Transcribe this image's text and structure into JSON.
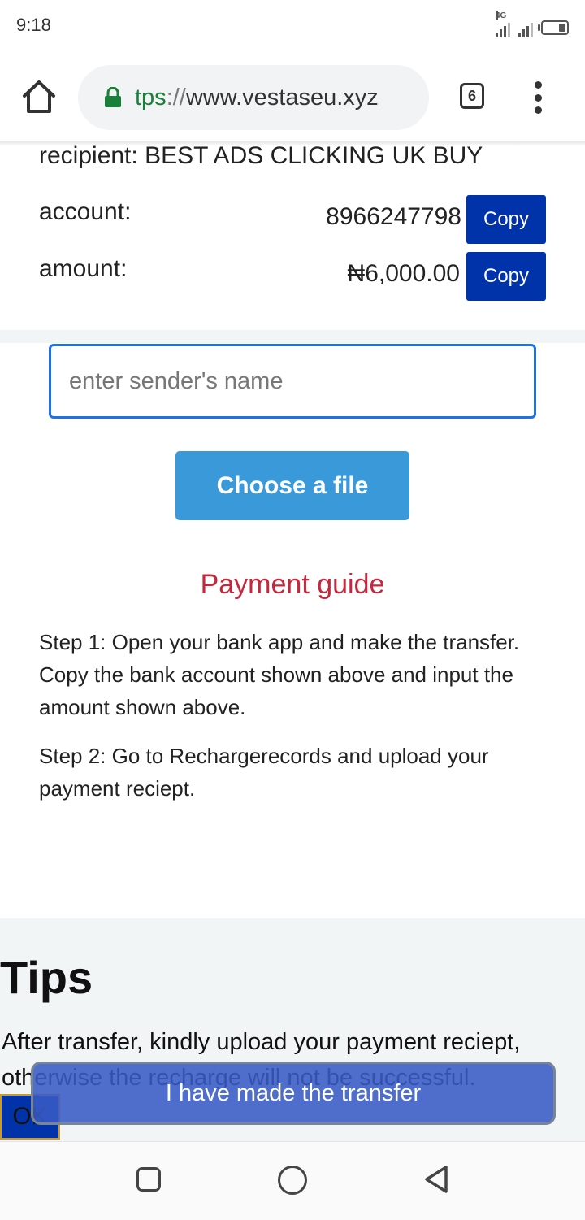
{
  "status": {
    "time": "9:18",
    "network": "4G"
  },
  "browser": {
    "url_scheme": "tps",
    "url_separator": "://",
    "url_host": "www.vestaseu.xyz",
    "tabs_count": "6"
  },
  "payment": {
    "recipient_line": "recipient: BEST ADS CLICKING UK BUY",
    "account_label": "account:",
    "account_value": "8966247798",
    "amount_label": "amount:",
    "amount_value": "₦6,000.00",
    "copy_label": "Copy"
  },
  "form": {
    "sender_placeholder": "enter sender's name",
    "choose_file_label": "Choose a file"
  },
  "guide": {
    "title": "Payment guide",
    "step1": "Step 1: Open your bank app and make the transfer. Copy the bank account shown above and input the amount shown above.",
    "step2": "Step 2: Go to Rechargerecords and upload your payment reciept."
  },
  "tips": {
    "title": "Tips",
    "text": "After transfer, kindly upload your payment reciept, otherwise the recharge will not be successful."
  },
  "buttons": {
    "ok_label": "OK",
    "transfer_label": "I have made the transfer"
  },
  "colors": {
    "primary_blue": "#0033aa",
    "file_button": "#3a9ad9",
    "guide_red": "#c5283d",
    "input_focus": "#1a73e8",
    "secure_green": "#188038"
  }
}
